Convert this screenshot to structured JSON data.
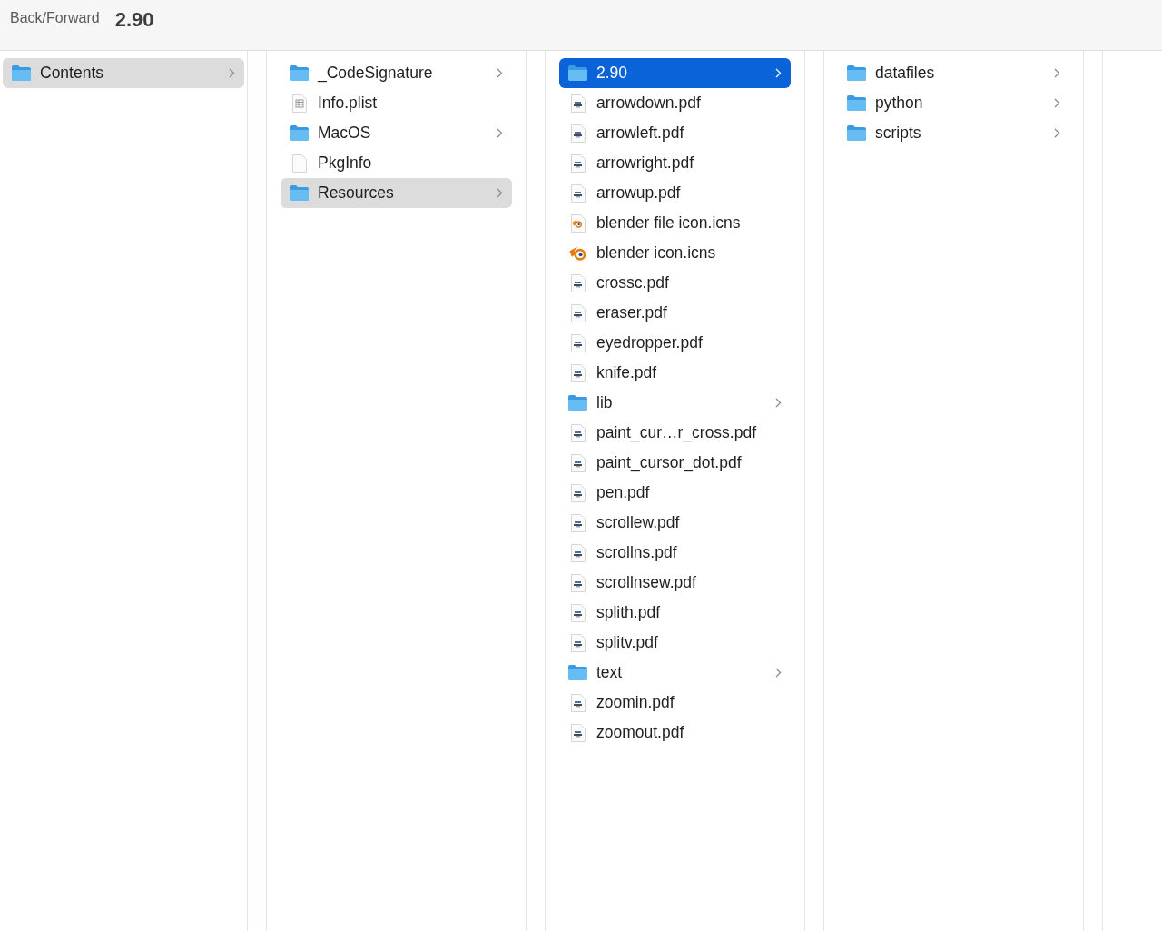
{
  "toolbar": {
    "back_forward": "Back/Forward",
    "title": "2.90"
  },
  "columns": [
    {
      "focused": false,
      "items": [
        {
          "kind": "folder",
          "name": "Contents",
          "selected": true,
          "has_children": true
        }
      ]
    },
    {
      "focused": false,
      "items": [
        {
          "kind": "folder",
          "name": "_CodeSignature",
          "selected": false,
          "has_children": true
        },
        {
          "kind": "plist",
          "name": "Info.plist",
          "selected": false,
          "has_children": false
        },
        {
          "kind": "folder",
          "name": "MacOS",
          "selected": false,
          "has_children": true
        },
        {
          "kind": "blank",
          "name": "PkgInfo",
          "selected": false,
          "has_children": false
        },
        {
          "kind": "folder",
          "name": "Resources",
          "selected": true,
          "has_children": true
        }
      ]
    },
    {
      "focused": true,
      "items": [
        {
          "kind": "folder",
          "name": "2.90",
          "selected": true,
          "has_children": true
        },
        {
          "kind": "pdf",
          "name": "arrowdown.pdf",
          "selected": false,
          "has_children": false
        },
        {
          "kind": "pdf",
          "name": "arrowleft.pdf",
          "selected": false,
          "has_children": false
        },
        {
          "kind": "pdf",
          "name": "arrowright.pdf",
          "selected": false,
          "has_children": false
        },
        {
          "kind": "pdf",
          "name": "arrowup.pdf",
          "selected": false,
          "has_children": false
        },
        {
          "kind": "blenderfile",
          "name": "blender file icon.icns",
          "selected": false,
          "has_children": false
        },
        {
          "kind": "blender",
          "name": "blender icon.icns",
          "selected": false,
          "has_children": false
        },
        {
          "kind": "pdf",
          "name": "crossc.pdf",
          "selected": false,
          "has_children": false
        },
        {
          "kind": "pdf",
          "name": "eraser.pdf",
          "selected": false,
          "has_children": false
        },
        {
          "kind": "pdf",
          "name": "eyedropper.pdf",
          "selected": false,
          "has_children": false
        },
        {
          "kind": "pdf",
          "name": "knife.pdf",
          "selected": false,
          "has_children": false
        },
        {
          "kind": "folder",
          "name": "lib",
          "selected": false,
          "has_children": true
        },
        {
          "kind": "pdf",
          "name": "paint_cur…r_cross.pdf",
          "selected": false,
          "has_children": false
        },
        {
          "kind": "pdf",
          "name": "paint_cursor_dot.pdf",
          "selected": false,
          "has_children": false
        },
        {
          "kind": "pdf",
          "name": "pen.pdf",
          "selected": false,
          "has_children": false
        },
        {
          "kind": "pdf",
          "name": "scrollew.pdf",
          "selected": false,
          "has_children": false
        },
        {
          "kind": "pdf",
          "name": "scrollns.pdf",
          "selected": false,
          "has_children": false
        },
        {
          "kind": "pdf",
          "name": "scrollnsew.pdf",
          "selected": false,
          "has_children": false
        },
        {
          "kind": "pdf",
          "name": "splith.pdf",
          "selected": false,
          "has_children": false
        },
        {
          "kind": "pdf",
          "name": "splitv.pdf",
          "selected": false,
          "has_children": false
        },
        {
          "kind": "folder",
          "name": "text",
          "selected": false,
          "has_children": true
        },
        {
          "kind": "pdf",
          "name": "zoomin.pdf",
          "selected": false,
          "has_children": false
        },
        {
          "kind": "pdf",
          "name": "zoomout.pdf",
          "selected": false,
          "has_children": false
        }
      ]
    },
    {
      "focused": false,
      "items": [
        {
          "kind": "folder",
          "name": "datafiles",
          "selected": false,
          "has_children": true
        },
        {
          "kind": "folder",
          "name": "python",
          "selected": false,
          "has_children": true
        },
        {
          "kind": "folder",
          "name": "scripts",
          "selected": false,
          "has_children": true
        }
      ]
    }
  ]
}
